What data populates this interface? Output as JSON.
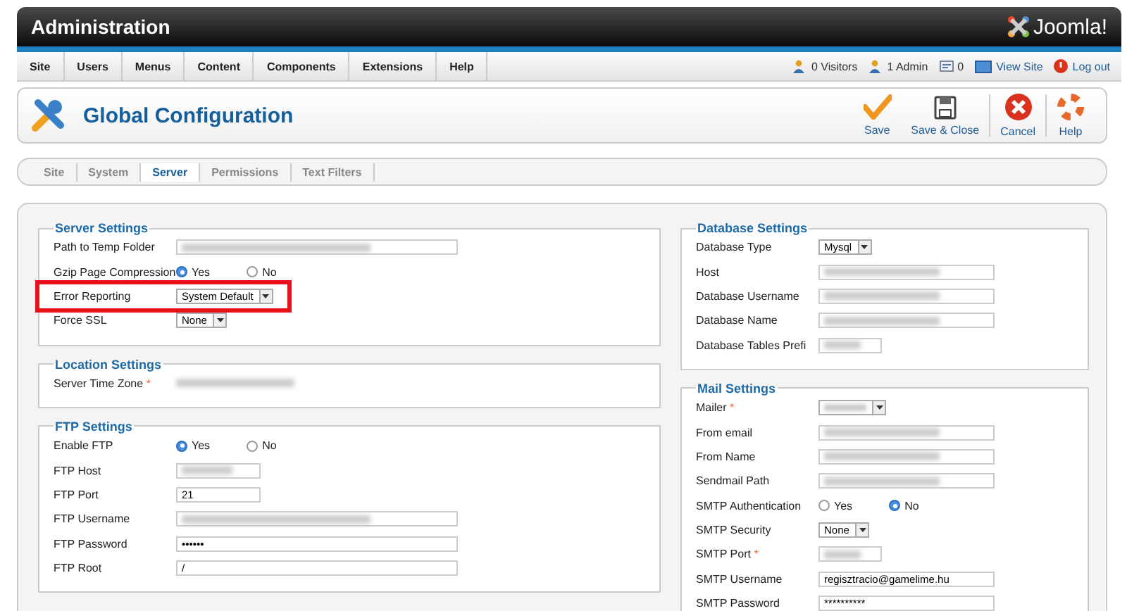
{
  "header": {
    "title": "Administration",
    "logo_text": "Joomla!"
  },
  "menu": {
    "items": [
      "Site",
      "Users",
      "Menus",
      "Content",
      "Components",
      "Extensions",
      "Help"
    ],
    "status": [
      {
        "kind": "visitors",
        "text": "0 Visitors"
      },
      {
        "kind": "admins",
        "text": "1 Admin"
      },
      {
        "kind": "messages",
        "text": "0"
      },
      {
        "kind": "view",
        "text": "View Site"
      },
      {
        "kind": "logout",
        "text": "Log out"
      }
    ]
  },
  "toolbar": {
    "title": "Global Configuration",
    "buttons": [
      {
        "kind": "save",
        "label": "Save"
      },
      {
        "kind": "save-close",
        "label": "Save & Close"
      },
      {
        "kind": "cancel",
        "label": "Cancel"
      },
      {
        "kind": "help",
        "label": "Help"
      }
    ]
  },
  "tabs": [
    {
      "label": "Site",
      "selected": false
    },
    {
      "label": "System",
      "selected": false
    },
    {
      "label": "Server",
      "selected": true
    },
    {
      "label": "Permissions",
      "selected": false
    },
    {
      "label": "Text Filters",
      "selected": false
    }
  ],
  "left_column": [
    {
      "legend": "Server Settings",
      "rows": [
        {
          "label": "Path to Temp Folder",
          "highlighted": false,
          "kind": "text"
        },
        {
          "label": "Gzip Page Compression",
          "highlighted": false,
          "kind": "radio",
          "options": [
            {
              "label": "Yes",
              "selected": true
            },
            {
              "label": "No",
              "selected": false
            }
          ]
        },
        {
          "label": "Error Reporting",
          "highlighted": true,
          "kind": "select",
          "value": "System Default"
        },
        {
          "label": "Force SSL",
          "highlighted": false,
          "kind": "select",
          "value": "None"
        }
      ]
    },
    {
      "legend": "Location Settings",
      "rows": [
        {
          "label": "Server Time Zone",
          "required_mark": "*",
          "highlighted": false,
          "kind": "plain"
        }
      ]
    },
    {
      "legend": "FTP Settings",
      "rows": [
        {
          "label": "Enable FTP",
          "highlighted": false,
          "kind": "radio",
          "options": [
            {
              "label": "Yes",
              "selected": true
            },
            {
              "label": "No",
              "selected": false
            }
          ]
        },
        {
          "label": "FTP Host",
          "highlighted": false,
          "kind": "short"
        },
        {
          "label": "FTP Port",
          "highlighted": false,
          "kind": "short",
          "value": "21"
        },
        {
          "label": "FTP Username",
          "highlighted": false,
          "kind": "text"
        },
        {
          "label": "FTP Password",
          "highlighted": false,
          "kind": "text",
          "value": "••••••"
        },
        {
          "label": "FTP Root",
          "highlighted": false,
          "kind": "long",
          "value": "/"
        }
      ]
    }
  ],
  "right_column": [
    {
      "legend": "Database Settings",
      "rows": [
        {
          "label": "Database Type",
          "highlighted": false,
          "kind": "select",
          "value": "Mysql"
        },
        {
          "label": "Host",
          "highlighted": false,
          "kind": "text"
        },
        {
          "label": "Database Username",
          "highlighted": false,
          "kind": "text"
        },
        {
          "label": "Database Name",
          "highlighted": false,
          "kind": "text"
        },
        {
          "label": "Database Tables Prefi",
          "highlighted": false,
          "kind": "short"
        }
      ]
    },
    {
      "legend": "Mail Settings",
      "rows": [
        {
          "label": "Mailer",
          "required_mark": "*",
          "highlighted": false,
          "kind": "select"
        },
        {
          "label": "From email",
          "highlighted": false,
          "kind": "text"
        },
        {
          "label": "From Name",
          "highlighted": false,
          "kind": "text"
        },
        {
          "label": "Sendmail Path",
          "highlighted": false,
          "kind": "text"
        },
        {
          "label": "SMTP Authentication",
          "highlighted": false,
          "kind": "radio",
          "options": [
            {
              "label": "Yes",
              "selected": false
            },
            {
              "label": "No",
              "selected": true
            }
          ]
        },
        {
          "label": "SMTP Security",
          "highlighted": false,
          "kind": "select",
          "value": "None"
        },
        {
          "label": "SMTP Port",
          "required_mark": "*",
          "highlighted": false,
          "kind": "short"
        },
        {
          "label": "SMTP Username",
          "highlighted": false,
          "kind": "text",
          "value": "regisztracio@gamelime.hu"
        },
        {
          "label": "SMTP Password",
          "highlighted": false,
          "kind": "text",
          "value": "**********"
        }
      ]
    }
  ]
}
